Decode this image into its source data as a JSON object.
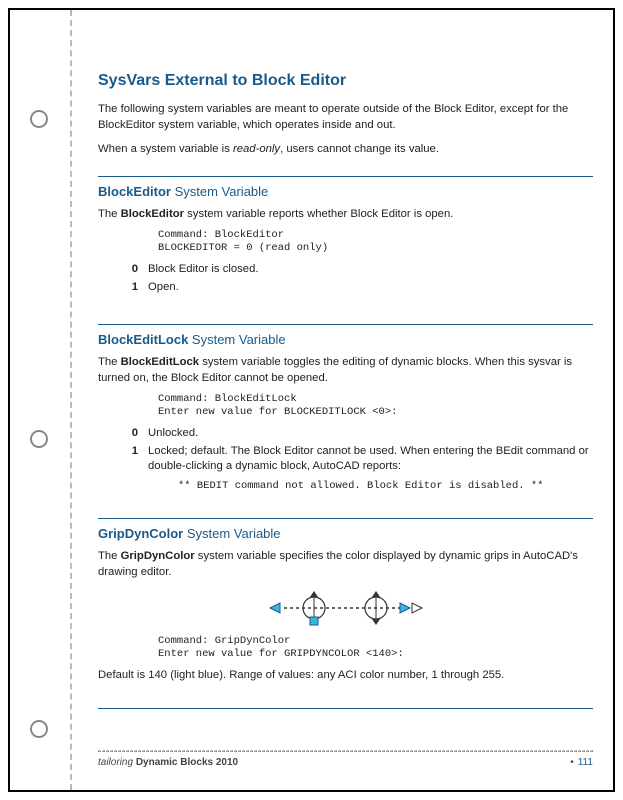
{
  "page": {
    "title": "SysVars External to Block Editor",
    "intro1_a": "The following system variables are meant to operate outside of the Block Editor, except for the BlockEditor system variable, which operates inside and out.",
    "intro2_a": "When a system variable is ",
    "intro2_em": "read-only",
    "intro2_b": ", users cannot change its value."
  },
  "sec1": {
    "var": "BlockEditor",
    "label": " System Variable",
    "body_a": "The ",
    "body_var": "BlockEditor",
    "body_b": " system variable reports whether Block Editor is open.",
    "code": "Command: BlockEditor\nBLOCKEDITOR = 0 (read only)",
    "d0k": "0",
    "d0v": "Block Editor is closed.",
    "d1k": "1",
    "d1v": "Open."
  },
  "sec2": {
    "var": "BlockEditLock",
    "label": " System Variable",
    "body_a": "The ",
    "body_var": "BlockEditLock",
    "body_b": " system variable toggles the editing of dynamic blocks. When this sysvar is turned on, the Block Editor cannot be opened.",
    "code": "Command: BlockEditLock\nEnter new value for BLOCKEDITLOCK <0>:",
    "d0k": "0",
    "d0v": "Unlocked.",
    "d1k": "1",
    "d1v": "Locked; default. The Block Editor cannot be used. When entering the BEdit command or double-clicking a dynamic block, AutoCAD reports:",
    "d1code": "** BEDIT command not allowed. Block Editor is disabled. **"
  },
  "sec3": {
    "var": "GripDynColor",
    "label": " System Variable",
    "body_a": "The ",
    "body_var": "GripDynColor",
    "body_b": "  system variable specifies the color displayed by dynamic grips in AutoCAD's drawing editor.",
    "code": "Command: GripDynColor\nEnter new value for GRIPDYNCOLOR <140>:",
    "body2": "Default is  140 (light blue). Range of values: any ACI color number, 1 through 255."
  },
  "footer": {
    "left_a": "tailoring ",
    "left_b": "Dynamic Blocks 2010",
    "pageno": "111"
  }
}
